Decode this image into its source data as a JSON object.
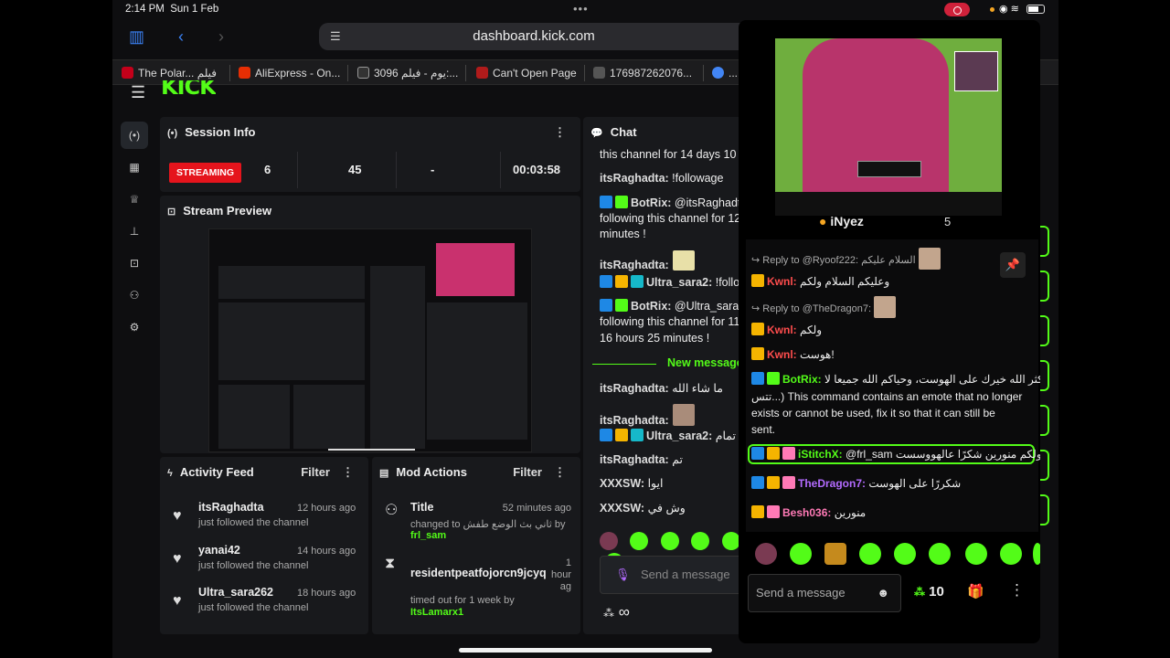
{
  "status": {
    "time": "2:14 PM",
    "date": "Sun 1 Feb"
  },
  "browser": {
    "url": "dashboard.kick.com",
    "tabs": [
      {
        "label": "The Polar... فيلم",
        "fav": "#c4001a"
      },
      {
        "label": "AliExpress - On...",
        "fav": "#e62e04"
      },
      {
        "label": "3096 يوم - فيلم:...",
        "fav": "#333333"
      },
      {
        "label": "Can't Open Page",
        "fav": "#b01b1b"
      },
      {
        "label": "176987262076...",
        "fav": "#555555"
      },
      {
        "label": "...",
        "fav": "#4285f4"
      }
    ]
  },
  "brand": {
    "logo": "KICK",
    "accent": "#53fc18"
  },
  "session": {
    "title": "Session Info",
    "status": "STREAMING",
    "stats": [
      "6",
      "45",
      "-",
      "00:03:58"
    ]
  },
  "preview": {
    "title": "Stream Preview"
  },
  "activity": {
    "title": "Activity Feed",
    "filter": "Filter",
    "items": [
      {
        "user": "itsRaghadta",
        "when": "12 hours ago",
        "desc": "just followed the channel"
      },
      {
        "user": "yanai42",
        "when": "14 hours ago",
        "desc": "just followed the channel"
      },
      {
        "user": "Ultra_sara262",
        "when": "18 hours ago",
        "desc": "just followed the channel"
      }
    ]
  },
  "mod": {
    "title": "Mod Actions",
    "filter": "Filter",
    "items": [
      {
        "title": "Title",
        "when": "52 minutes ago",
        "desc": "changed to ثاني بث الوضع طفش by",
        "by": "frl_sam"
      },
      {
        "title": "residentpeatfojorcn9jcyq",
        "when": "1 hour ag",
        "desc": "timed out for 1 week by",
        "by": "ItsLamarx1"
      }
    ]
  },
  "chat": {
    "title": "Chat",
    "lines": [
      {
        "text": "this channel for 14 days 10 h"
      },
      {
        "user": "itsRaghadta:",
        "text": " !followage"
      },
      {
        "user": "BotRix:",
        "text": " @itsRaghadta"
      },
      {
        "text": "following this channel for 12"
      },
      {
        "text": "minutes !"
      },
      {
        "user": "itsRaghadta:",
        "text": ""
      },
      {
        "user": "Ultra_sara2:",
        "text": " !follo"
      },
      {
        "user": "BotRix:",
        "text": " @Ultra_sara2"
      },
      {
        "text": "following this channel for 11"
      },
      {
        "text": "16 hours 25 minutes !"
      },
      {
        "user": "itsRaghadta:",
        "text": " ما شاء الله"
      },
      {
        "user": "itsRaghadta:",
        "text": ""
      },
      {
        "user": "Ultra_sara2:",
        "text": " تمام"
      },
      {
        "user": "itsRaghadta:",
        "text": " تم"
      },
      {
        "user": "XXXSW:",
        "text": " ايوا"
      },
      {
        "user": "XXXSW:",
        "text": " وش في"
      }
    ],
    "new_messages": "New messages",
    "placeholder": "Send a message",
    "infinity": "∞"
  },
  "popout": {
    "streamer": "iNyez",
    "viewers": "5",
    "reply1": "Reply to @Ryoof222: السلام عليكم",
    "line1_user": "Kwnl:",
    "line1_text": " وعليكم السلام ولكم",
    "reply2": "Reply to @TheDragon7:",
    "line2_user": "Kwnl:",
    "line2_text": " ولكم",
    "line3_user": "Kwnl:",
    "line3_text": " هوست!",
    "bot_user": "BotRix:",
    "bot_l1": " كثر الله خيرك على الهوست، وحياكم الله جميعا لا)",
    "bot_l2": "تتس...) This command contains an emote that no longer",
    "bot_l3": "exists or cannot be used, fix it so that it can still be",
    "bot_l4": "sent.",
    "hl_user": "iStitchX:",
    "hl_text": " @frl_sam ولكم منورين شكرًا عالهووسست",
    "l5_user": "TheDragon7:",
    "l5_text": " شكررًا على الهوست",
    "l6_user": "Besh036:",
    "l6_text": " منورين",
    "placeholder": "Send a message",
    "points": "10"
  },
  "colors": {
    "red_user": "#ff4d4d",
    "purple_user": "#b36bff",
    "pink_user": "#ff7ab6"
  }
}
